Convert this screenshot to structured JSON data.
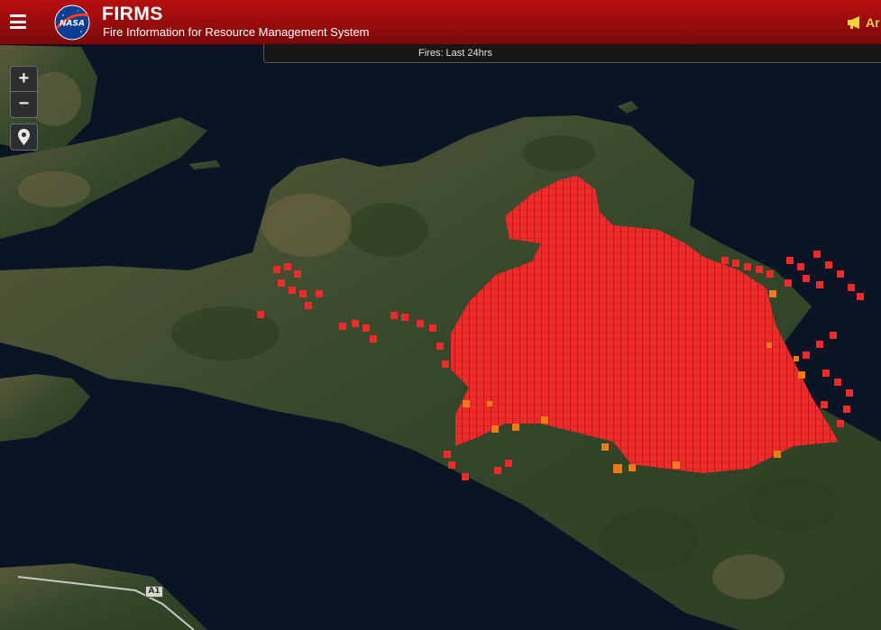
{
  "header": {
    "title": "FIRMS",
    "subtitle": "Fire Information for Resource Management System",
    "logo_text": "NASA",
    "announcement_label": "Ar"
  },
  "fires_tab": {
    "label": "Fires: Last 24hrs"
  },
  "controls": {
    "zoom_in": "+",
    "zoom_out": "−"
  },
  "map": {
    "road_label": "A1",
    "colors": {
      "sea": "#0b1424",
      "land": "#3d4a2c",
      "fire_red": "#ee2a2a",
      "fire_orange": "#f07a1a"
    }
  },
  "icons": {
    "menu": "hamburger-menu-icon",
    "logo": "nasa-logo-icon",
    "announcement": "megaphone-icon",
    "location": "map-pin-icon"
  }
}
